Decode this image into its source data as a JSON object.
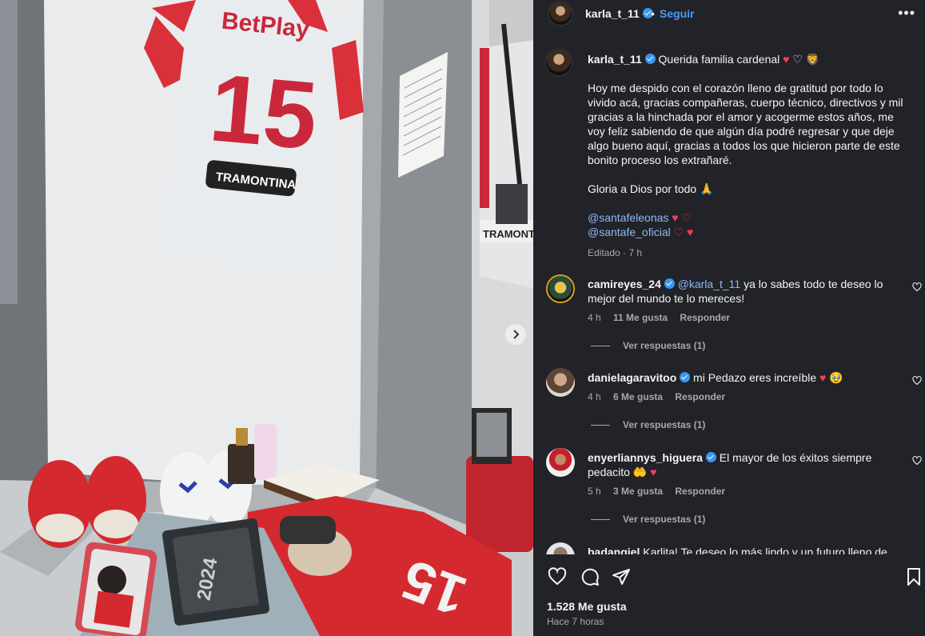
{
  "post": {
    "username": "karla_t_11",
    "follow_label": "Seguir",
    "more_label": "•••",
    "dot": "•"
  },
  "caption": {
    "username": "karla_t_11",
    "headline": "Querida familia cardenal",
    "headline_emojis": [
      "♥",
      "♡",
      "🦁"
    ],
    "paragraph_1": "Hoy me despido con el corazón lleno de gratitud por todo lo vivido acá, gracias compañeras, cuerpo técnico, directivos y mil gracias a la hinchada por el amor y acogerme estos años, me voy feliz sabiendo de que algún día podré regresar y que deje algo bueno aquí, gracias a todos los que hicieron parte de este bonito proceso los extrañaré.",
    "paragraph_2": "Gloria a Dios por todo",
    "paragraph_2_emoji": "🙏",
    "mention_1": "@santafeleonas",
    "mention_1_emojis": "♥ ♡",
    "mention_2": "@santafe_oficial",
    "mention_2_emojis": "♡ ♥",
    "edited_label": "Editado",
    "edited_time": "7 h"
  },
  "comments": [
    {
      "username": "camireyes_24",
      "mention": "@karla_t_11",
      "text": "ya lo sabes todo te deseo lo mejor del mundo te lo mereces!",
      "time": "4 h",
      "likes": "11 Me gusta",
      "reply_label": "Responder",
      "view_replies": "Ver respuestas (1)"
    },
    {
      "username": "danielagaravitoo",
      "mention": "",
      "text": "mi Pedazo eres increíble",
      "emoji": "♥ 🥹",
      "time": "4 h",
      "likes": "6 Me gusta",
      "reply_label": "Responder",
      "view_replies": "Ver respuestas (1)"
    },
    {
      "username": "enyerliannys_higuera",
      "mention": "",
      "text": "El mayor de los éxitos siempre pedacito",
      "emoji": "🤲 ♥",
      "time": "5 h",
      "likes": "3 Me gusta",
      "reply_label": "Responder",
      "view_replies": "Ver respuestas (1)"
    },
    {
      "username": "badangiel",
      "mention": "",
      "text": "Karlita! Te deseo lo más lindo y un futuro lleno de"
    }
  ],
  "footer": {
    "likes": "1.528 Me gusta",
    "time_ago": "Hace 7 horas"
  },
  "photo": {
    "jersey_sponsor": "BetPlay",
    "jersey_number": "15",
    "jersey_badge": "TRAMONTINA",
    "mirror_badge": "TRAMONTINA",
    "box_year": "2024"
  },
  "colors": {
    "panel_bg": "#212328",
    "link_blue": "#4a9bf4",
    "mention_blue": "#8fb8f5",
    "heart_red": "#ff3b5c",
    "verified_blue": "#3897f0"
  },
  "icons": [
    "verified-badge-icon",
    "more-options-icon",
    "heart-icon",
    "comment-icon",
    "share-icon",
    "bookmark-icon",
    "chevron-right-icon"
  ]
}
